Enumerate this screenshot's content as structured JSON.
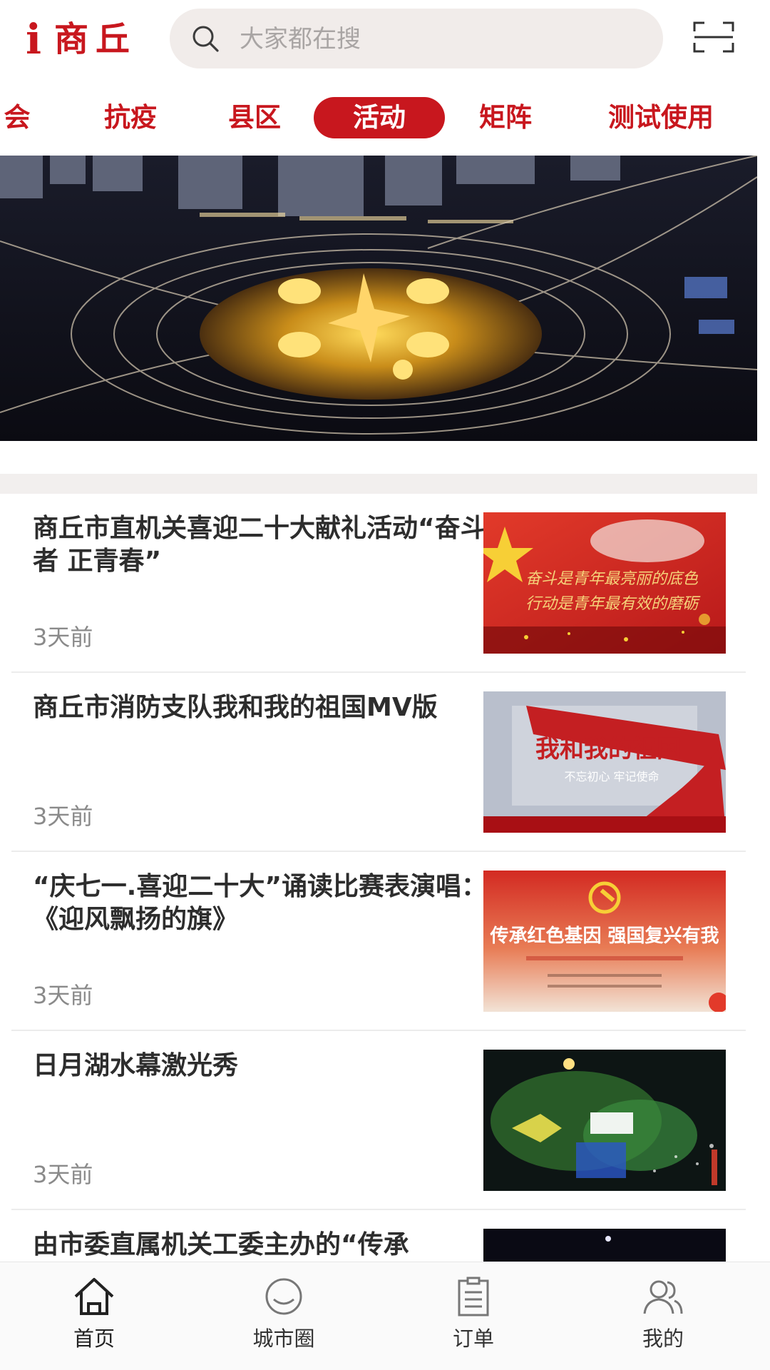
{
  "header": {
    "logo_i": "i",
    "logo_text": "商丘",
    "search_placeholder": "大家都在搜"
  },
  "tabs": [
    {
      "label": "会",
      "active": false
    },
    {
      "label": "抗疫",
      "active": false
    },
    {
      "label": "县区",
      "active": false
    },
    {
      "label": "活动",
      "active": true
    },
    {
      "label": "矩阵",
      "active": false
    },
    {
      "label": "测试使用",
      "active": false
    }
  ],
  "news": [
    {
      "title": "商丘市直机关喜迎二十大献礼活动“奋斗者 正青春”",
      "time": "3天前",
      "thumb_text": [
        "奋斗是青年最亮丽的底色",
        "行动是青年最有效的磨砺"
      ]
    },
    {
      "title": "商丘市消防支队我和我的祖国MV版",
      "time": "3天前",
      "thumb_text": [
        "我和我的祖国",
        "不忘初心 牢记使命"
      ]
    },
    {
      "title": "“庆七一.喜迎二十大”诵读比赛表演唱：《迎风飘扬的旗》",
      "time": "3天前",
      "thumb_text": [
        "传承红色基因 强国复兴有我"
      ]
    },
    {
      "title": "日月湖水幕激光秀",
      "time": "3天前",
      "thumb_text": []
    },
    {
      "title": "由市委直属机关工委主办的“传承",
      "time": "",
      "thumb_text": []
    }
  ],
  "bottom_nav": [
    {
      "label": "首页",
      "icon": "home-icon",
      "active": true
    },
    {
      "label": "城市圈",
      "icon": "city-circle-icon",
      "active": false
    },
    {
      "label": "订单",
      "icon": "order-icon",
      "active": false
    },
    {
      "label": "我的",
      "icon": "user-icon",
      "active": false
    }
  ],
  "colors": {
    "brand_red": "#c8171e",
    "search_bg": "#f1ecea",
    "text_dark": "#2d2d2d",
    "text_gray": "#8a8a8a"
  }
}
